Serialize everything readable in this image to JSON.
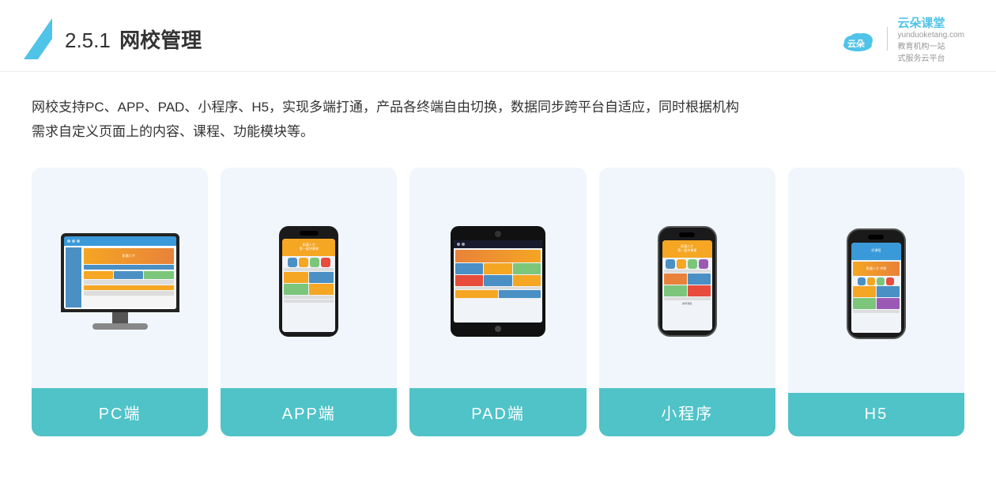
{
  "header": {
    "section_number": "2.5.1",
    "title_plain": "网校管理",
    "brand": {
      "name": "云朵课堂",
      "url": "yunduoketang.com",
      "slogan_line1": "教育机构一站",
      "slogan_line2": "式服务云平台"
    }
  },
  "description": {
    "line1": "网校支持PC、APP、PAD、小程序、H5，实现多端打通，产品各终端自由切换，数据同步跨平台自适应，同时根据机构",
    "line2": "需求自定义页面上的内容、课程、功能模块等。"
  },
  "cards": [
    {
      "id": "pc",
      "label": "PC端"
    },
    {
      "id": "app",
      "label": "APP端"
    },
    {
      "id": "pad",
      "label": "PAD端"
    },
    {
      "id": "miniapp",
      "label": "小程序"
    },
    {
      "id": "h5",
      "label": "H5"
    }
  ]
}
